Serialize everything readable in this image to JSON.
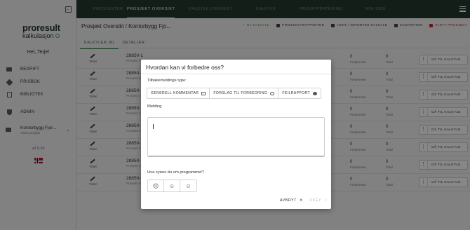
{
  "sidebar": {
    "collapse_icon": "←",
    "logo_main": "proresult",
    "logo_sub": "kalkulasjon",
    "greeting": "Hei, Terje!",
    "items": [
      {
        "label": "BEDRIFT",
        "icon": "building-icon"
      },
      {
        "label": "PRISBOK",
        "icon": "price-tag-icon"
      },
      {
        "label": "BIBLIOTEK",
        "icon": "book-icon"
      },
      {
        "label": "ADMIN",
        "icon": "shield-icon"
      }
    ],
    "project": {
      "name": "Kontorbygg Fjor...",
      "status": "Aktivt prosjekt"
    },
    "version": "v2.0.30"
  },
  "topnav": {
    "tabs": [
      {
        "label": "PROSJEKTER"
      },
      {
        "label": "PROSJEKT OVERSIKT"
      },
      {
        "label": "KALKYLE OVERSIKT"
      },
      {
        "label": "KALKYLE"
      },
      {
        "label": "PRISOPPDATERING"
      },
      {
        "label": "MIN SIDE"
      }
    ]
  },
  "main": {
    "breadcrumb": "Prosjekt Oversikt / Kontorbygg Fjo...",
    "actions": [
      {
        "label": "NY KALKYLE",
        "tone": "green"
      },
      {
        "label": "PROSJEKTRAPPORTER",
        "tone": "normal"
      },
      {
        "label": "HENT / IMPORTER KALKYLE",
        "tone": "normal"
      },
      {
        "label": "EKSPORTER",
        "tone": "normal"
      },
      {
        "label": "SLETT PROSJEKT",
        "tone": "red"
      }
    ],
    "subtabs": [
      "KALKYLER (8)",
      "DETALJER"
    ],
    "rows": [
      {
        "type": "Yrker",
        "number": "28850-1",
        "sub": "Prosjekt mmer",
        "value1": "0",
        "label1": "Fortjeneste",
        "value2": "0",
        "label2": "Total",
        "goto": "GÅ TIL KALKYLE"
      },
      {
        "type": "Yrker",
        "number": "28850-1",
        "sub": "Prosjekt mmer",
        "value1": "0",
        "label1": "Fortjeneste",
        "value2": "0",
        "label2": "Total",
        "goto": "GÅ TIL KALKYLE"
      },
      {
        "type": "Yrker",
        "number": "28850-1",
        "sub": "Prosjekt mmer",
        "value1": "0",
        "label1": "Fortjeneste",
        "value2": "0",
        "label2": "Total",
        "goto": "GÅ TIL KALKYLE"
      },
      {
        "type": "Yrker",
        "number": "28850-1",
        "sub": "Prosjekt mmer",
        "value1": "0",
        "label1": "Fortjeneste",
        "value2": "0",
        "label2": "Total",
        "goto": "GÅ TIL KALKYLE"
      },
      {
        "type": "Yrker",
        "number": "28850-1",
        "sub": "Prosjekt mmer",
        "value1": "0",
        "label1": "Fortjeneste",
        "value2": "0",
        "label2": "Total",
        "goto": "GÅ TIL KALKYLE"
      },
      {
        "type": "Yrker",
        "number": "28850-1",
        "sub": "Prosjekt mmer",
        "value1": "0",
        "label1": "Fortjeneste",
        "value2": "0",
        "label2": "Total",
        "goto": "GÅ TIL KALKYLE"
      },
      {
        "type": "Yrker",
        "number": "28850-1",
        "sub": "Prosjekt mmer",
        "value1": "0",
        "label1": "Fortjeneste",
        "value2": "0",
        "label2": "Total",
        "goto": "GÅ TIL KALKYLE"
      },
      {
        "type": "Yrker",
        "number": "28850-1",
        "sub": "Prosjekt mmer",
        "value1": "0",
        "label1": "Fortjeneste",
        "value2": "0",
        "label2": "Total",
        "goto": "GÅ TIL KALKYLE"
      }
    ]
  },
  "modal": {
    "title": "Hvordan kan vi forbedre oss?",
    "type_label": "Tilbakemeldings type:",
    "options": [
      {
        "label": "GENERELL KOMMENTAR",
        "icon": "comment-icon"
      },
      {
        "label": "FORSLAG TIL FORBEDRING",
        "icon": "lightbulb-icon"
      },
      {
        "label": "FEILRAPPORT",
        "icon": "bug-icon"
      }
    ],
    "message_label": "Melding",
    "message_value": "",
    "rating_label": "Hva synes du om programmet?",
    "faces": [
      "☹",
      "☺",
      "☺"
    ],
    "cancel": "AVBRYT",
    "ok": "OKEY"
  },
  "colors": {
    "topnav": "#243a2f",
    "accent": "#2f7a3f",
    "danger": "#c62828"
  }
}
